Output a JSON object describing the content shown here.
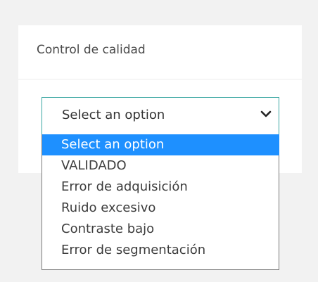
{
  "card": {
    "title": "Control de calidad"
  },
  "select": {
    "value": "Select an option",
    "icon": "chevron-down-icon",
    "options": [
      "Select an option",
      "VALIDADO",
      "Error de adquisición",
      "Ruido excesivo",
      "Contraste bajo",
      "Error de segmentación"
    ],
    "highlighted_index": 0
  },
  "colors": {
    "page_background": "#f2f2f2",
    "card_background": "#ffffff",
    "select_border": "#3aa6a2",
    "highlight": "#1e90ff",
    "text": "#333333"
  }
}
